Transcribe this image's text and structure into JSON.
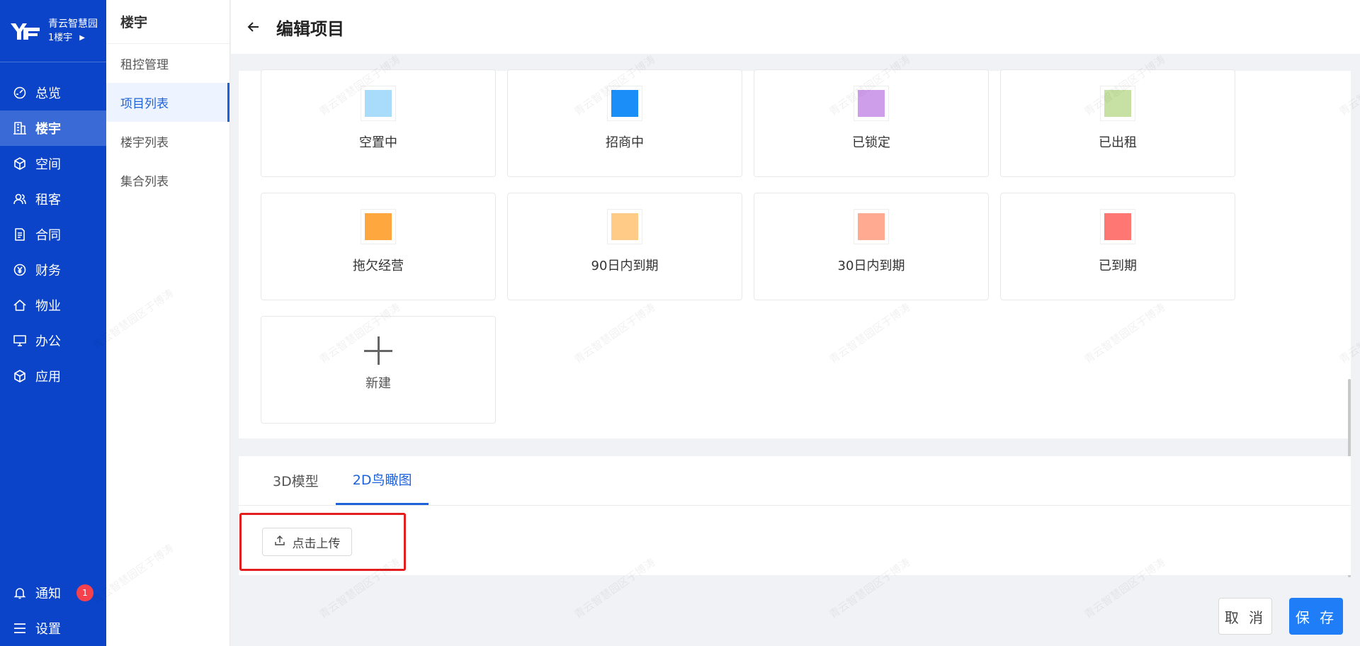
{
  "org": {
    "name": "青云智慧园区",
    "sub": "1楼宇"
  },
  "nav": {
    "items": [
      {
        "label": "总览",
        "icon": "dashboard-icon"
      },
      {
        "label": "楼宇",
        "icon": "building-icon"
      },
      {
        "label": "空间",
        "icon": "cube-icon"
      },
      {
        "label": "租客",
        "icon": "users-icon"
      },
      {
        "label": "合同",
        "icon": "document-icon"
      },
      {
        "label": "财务",
        "icon": "yen-icon"
      },
      {
        "label": "物业",
        "icon": "home-icon"
      },
      {
        "label": "办公",
        "icon": "monitor-icon"
      },
      {
        "label": "应用",
        "icon": "app-icon"
      }
    ],
    "bottom": [
      {
        "label": "通知",
        "icon": "bell-icon",
        "badge": "1"
      },
      {
        "label": "设置",
        "icon": "menu-icon"
      }
    ]
  },
  "subnav": {
    "title": "楼宇",
    "items": [
      "租控管理",
      "项目列表",
      "楼宇列表",
      "集合列表"
    ]
  },
  "header": {
    "title": "编辑项目"
  },
  "status_cards": [
    {
      "label": "空置中",
      "color": "#a9dcfb"
    },
    {
      "label": "招商中",
      "color": "#1b8ef7"
    },
    {
      "label": "已锁定",
      "color": "#cf9eeb"
    },
    {
      "label": "已出租",
      "color": "#c6e1a3"
    },
    {
      "label": "拖欠经营",
      "color": "#fea73e"
    },
    {
      "label": "90日内到期",
      "color": "#ffcb86"
    },
    {
      "label": "30日内到期",
      "color": "#ffaa91"
    },
    {
      "label": "已到期",
      "color": "#ff7773"
    }
  ],
  "new_card": {
    "label": "新建"
  },
  "tabs": [
    "3D模型",
    "2D鸟瞰图"
  ],
  "upload": {
    "label": "点击上传"
  },
  "footer": {
    "cancel": "取 消",
    "save": "保 存"
  },
  "watermark": "青云智慧园区于博涛"
}
